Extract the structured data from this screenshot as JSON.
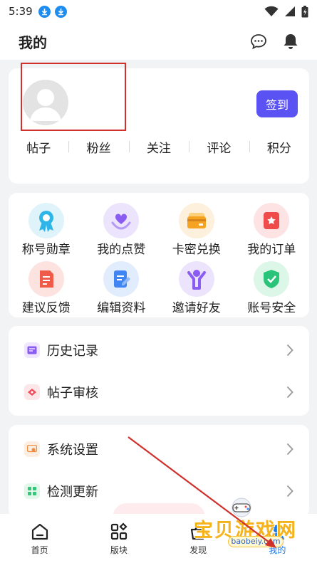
{
  "status_bar": {
    "time": "5:39"
  },
  "header": {
    "title": "我的"
  },
  "profile": {
    "checkin_label": "签到",
    "stats": [
      "帖子",
      "粉丝",
      "关注",
      "评论",
      "积分"
    ]
  },
  "grid": {
    "items": [
      {
        "label": "称号勋章",
        "icon": "medal-icon",
        "color": "#2fb6e8"
      },
      {
        "label": "我的点赞",
        "icon": "heart-hand-icon",
        "color": "#8a5cf2"
      },
      {
        "label": "卡密兑换",
        "icon": "card-icon",
        "color": "#f6a321"
      },
      {
        "label": "我的订单",
        "icon": "order-icon",
        "color": "#ef4b4b"
      },
      {
        "label": "建议反馈",
        "icon": "feedback-icon",
        "color": "#f05a4a"
      },
      {
        "label": "编辑资料",
        "icon": "edit-icon",
        "color": "#3f86f2"
      },
      {
        "label": "邀请好友",
        "icon": "invite-icon",
        "color": "#8a5cf2"
      },
      {
        "label": "账号安全",
        "icon": "shield-icon",
        "color": "#29c47a"
      }
    ]
  },
  "lists": {
    "history": "历史记录",
    "review": "帖子审核",
    "settings": "系统设置",
    "update": "检测更新"
  },
  "tabbar": {
    "home": "首页",
    "sections": "版块",
    "discover": "发现",
    "mine": "我的"
  },
  "watermark": {
    "text": "宝贝游戏网",
    "url": "baobeiy.com"
  },
  "colors": {
    "accent": "#5a52f2",
    "tab_active": "#1e7ae8"
  }
}
